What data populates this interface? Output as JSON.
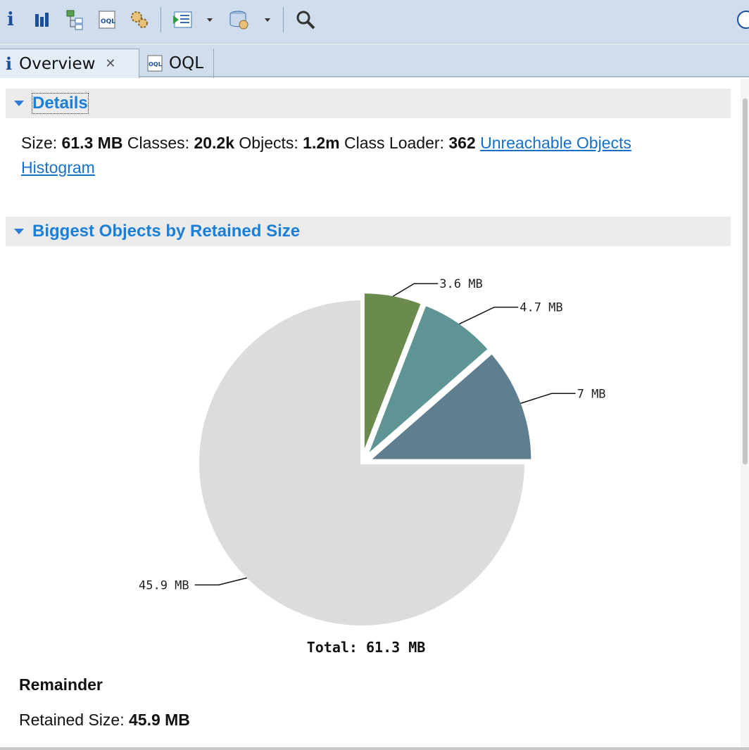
{
  "toolbar": {
    "items": [
      {
        "icon": "info-icon",
        "glyph": "i"
      },
      {
        "icon": "histogram-icon"
      },
      {
        "icon": "dominator-tree-icon"
      },
      {
        "icon": "oql-icon",
        "text": "OQL"
      },
      {
        "icon": "thread-overview-icon"
      },
      {
        "icon": "run-report-icon"
      },
      {
        "icon": "query-browser-icon"
      },
      {
        "icon": "search-icon"
      },
      {
        "icon": "help-icon"
      }
    ]
  },
  "tabs": [
    {
      "label": "Overview",
      "active": true,
      "icon": "info-icon",
      "close_glyph": "✕"
    },
    {
      "label": "OQL",
      "active": false,
      "icon": "oql-icon",
      "icon_text": "OQL"
    }
  ],
  "details": {
    "title": "Details",
    "size_label": "Size:",
    "size_value": "61.3 MB",
    "classes_label": "Classes:",
    "classes_value": "20.2k",
    "objects_label": "Objects:",
    "objects_value": "1.2m",
    "class_loader_label": "Class Loader:",
    "class_loader_value": "362",
    "link_unreachable": "Unreachable Objects",
    "link_histogram": "Histogram"
  },
  "biggest_objects": {
    "title": "Biggest Objects by Retained Size",
    "total_label": "Total: 61.3 MB",
    "remainder_title": "Remainder",
    "retained_label": "Retained Size:",
    "retained_value": "45.9 MB"
  },
  "chart_data": {
    "type": "pie",
    "categories": [
      "3.6 MB",
      "4.7 MB",
      "7 MB",
      "45.9 MB"
    ],
    "values": [
      3.6,
      4.7,
      7.0,
      45.9
    ],
    "labels": [
      "3.6 MB",
      "4.7 MB",
      "7 MB",
      "45.9 MB"
    ],
    "colors": [
      "#6b8a4d",
      "#5f9494",
      "#5f7e90",
      "#dcdcdc"
    ],
    "exploded": [
      true,
      true,
      true,
      false
    ],
    "start_angle_deg": 0,
    "direction": "clockwise",
    "total": "Total: 61.3 MB"
  },
  "colors": {
    "toolbar_bg": "#cfdded",
    "section_title": "#1a7fd9",
    "link": "#1570c9"
  }
}
